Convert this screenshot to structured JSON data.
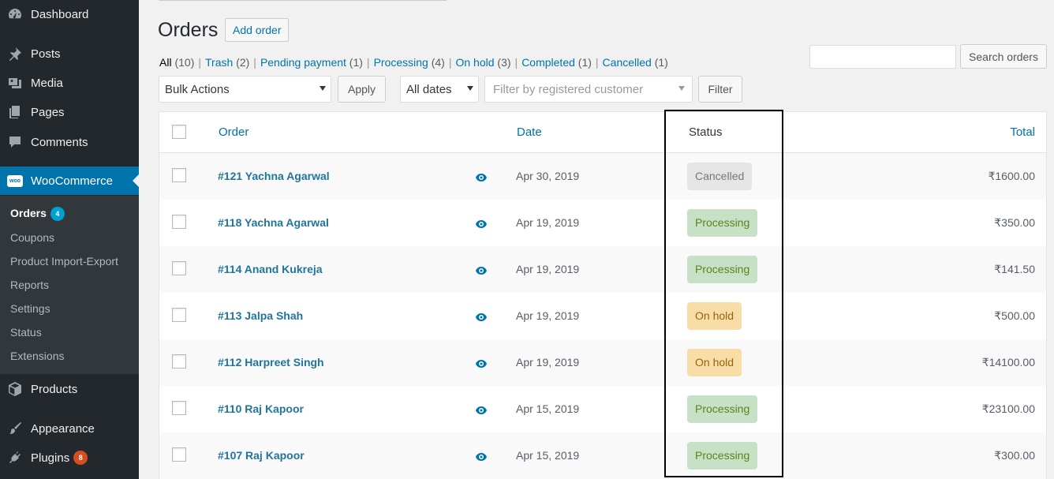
{
  "sidebar": {
    "items": [
      {
        "label": "Dashboard",
        "icon": "dashboard-icon"
      },
      {
        "label": "Posts",
        "icon": "pin-icon"
      },
      {
        "label": "Media",
        "icon": "media-icon"
      },
      {
        "label": "Pages",
        "icon": "pages-icon"
      },
      {
        "label": "Comments",
        "icon": "comment-icon"
      },
      {
        "label": "WooCommerce",
        "icon": "woocommerce-icon"
      }
    ],
    "submenu": [
      {
        "label": "Orders",
        "badge": "4"
      },
      {
        "label": "Coupons"
      },
      {
        "label": "Product Import-Export"
      },
      {
        "label": "Reports"
      },
      {
        "label": "Settings"
      },
      {
        "label": "Status"
      },
      {
        "label": "Extensions"
      }
    ],
    "lower_items": [
      {
        "label": "Products",
        "icon": "box-icon"
      },
      {
        "label": "Appearance",
        "icon": "brush-icon"
      },
      {
        "label": "Plugins",
        "icon": "plug-icon",
        "badge": "8"
      }
    ],
    "woo_logo_text": "woo"
  },
  "header": {
    "title": "Orders",
    "add_button": "Add order"
  },
  "filters": {
    "views": [
      {
        "label": "All",
        "count": "(10)"
      },
      {
        "label": "Trash",
        "count": "(2)"
      },
      {
        "label": "Pending payment",
        "count": "(1)"
      },
      {
        "label": "Processing",
        "count": "(4)"
      },
      {
        "label": "On hold",
        "count": "(3)"
      },
      {
        "label": "Completed",
        "count": "(1)"
      },
      {
        "label": "Cancelled",
        "count": "(1)"
      }
    ],
    "separator": "|",
    "bulk_actions": "Bulk Actions",
    "apply": "Apply",
    "dates": "All dates",
    "customer_placeholder": "Filter by registered customer",
    "filter_button": "Filter",
    "search_button": "Search orders"
  },
  "table": {
    "columns": {
      "order": "Order",
      "date": "Date",
      "status": "Status",
      "total": "Total"
    },
    "rows": [
      {
        "order": "#121 Yachna Agarwal",
        "date": "Apr 30, 2019",
        "status": "Cancelled",
        "status_key": "cancelled",
        "total": "₹1600.00"
      },
      {
        "order": "#118 Yachna Agarwal",
        "date": "Apr 19, 2019",
        "status": "Processing",
        "status_key": "processing",
        "total": "₹350.00"
      },
      {
        "order": "#114 Anand Kukreja",
        "date": "Apr 19, 2019",
        "status": "Processing",
        "status_key": "processing",
        "total": "₹141.50"
      },
      {
        "order": "#113 Jalpa Shah",
        "date": "Apr 19, 2019",
        "status": "On hold",
        "status_key": "on-hold",
        "total": "₹500.00"
      },
      {
        "order": "#112 Harpreet Singh",
        "date": "Apr 19, 2019",
        "status": "On hold",
        "status_key": "on-hold",
        "total": "₹14100.00"
      },
      {
        "order": "#110 Raj Kapoor",
        "date": "Apr 15, 2019",
        "status": "Processing",
        "status_key": "processing",
        "total": "₹23100.00"
      },
      {
        "order": "#107 Raj Kapoor",
        "date": "Apr 15, 2019",
        "status": "Processing",
        "status_key": "processing",
        "total": "₹300.00"
      }
    ]
  },
  "colors": {
    "sidebar_bg": "#23282d",
    "accent": "#0073aa",
    "processing_bg": "#c6e1c6",
    "on_hold_bg": "#f8dda7",
    "cancelled_bg": "#e5e5e5"
  }
}
